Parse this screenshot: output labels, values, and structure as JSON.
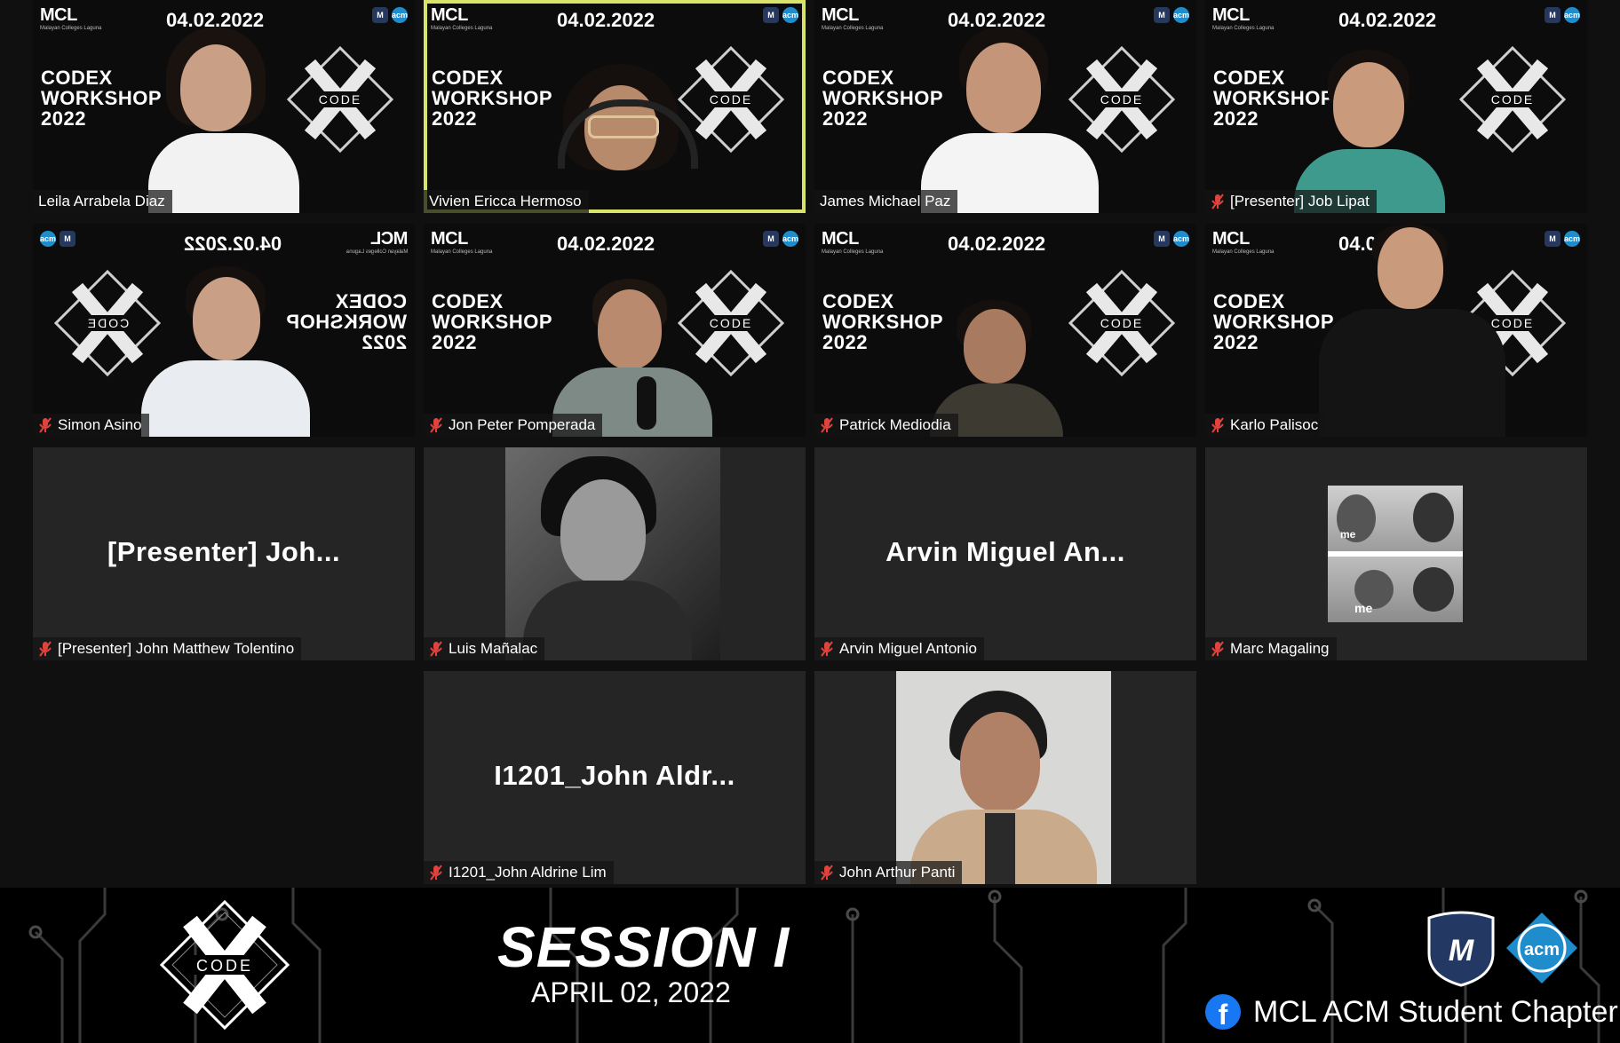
{
  "tile_text": {
    "date": "04.02.2022",
    "logo": "MCL",
    "logo_sub": "Malayan Colleges Laguna",
    "badge_m": "M",
    "badge_acm": "acm",
    "workshop_line1": "CODEX",
    "workshop_line2": "WORKSHOP",
    "workshop_line3": "2022",
    "code_word": "CODE"
  },
  "participants": [
    {
      "name": "Leila Arrabela Diaz",
      "muted": false,
      "active": false
    },
    {
      "name": "Vivien Ericca Hermoso",
      "muted": false,
      "active": true
    },
    {
      "name": "James Michael Paz",
      "muted": false,
      "active": false
    },
    {
      "name": "[Presenter] Job Lipat",
      "muted": true,
      "active": false
    },
    {
      "name": "Simon Asino",
      "muted": true,
      "active": false
    },
    {
      "name": "Jon Peter Pomperada",
      "muted": true,
      "active": false
    },
    {
      "name": "Patrick Mediodia",
      "muted": true,
      "active": false
    },
    {
      "name": "Karlo Palisoc",
      "muted": true,
      "active": false
    },
    {
      "name": "[Presenter]  John Matthew Tolentino",
      "display": "[Presenter]   Joh...",
      "muted": true
    },
    {
      "name": "Luis Mañalac",
      "muted": true
    },
    {
      "name": "Arvin Miguel Antonio",
      "display": "Arvin  Miguel  An...",
      "muted": true
    },
    {
      "name": "Marc Magaling",
      "muted": true,
      "meme_text_1": "me",
      "meme_text_2": "me"
    },
    {
      "name": "I1201_John Aldrine Lim",
      "display": "I1201_John  Aldr...",
      "muted": true
    },
    {
      "name": "John Arthur Panti",
      "muted": true
    }
  ],
  "banner": {
    "session_title": "SESSION I",
    "session_date": "APRIL 02, 2022",
    "code_logo_text": "CODE",
    "mcl_logo": "M",
    "acm_logo": "acm",
    "fb_icon": "f",
    "fb_page": "MCL ACM Student Chapter"
  },
  "colors": {
    "active_speaker_border": "#d8e36a",
    "muted_icon": "#e0433d",
    "tile_background": "#252525",
    "mcl_blue": "#26385e",
    "acm_blue": "#1f8ccc",
    "facebook_blue": "#1877f2"
  }
}
